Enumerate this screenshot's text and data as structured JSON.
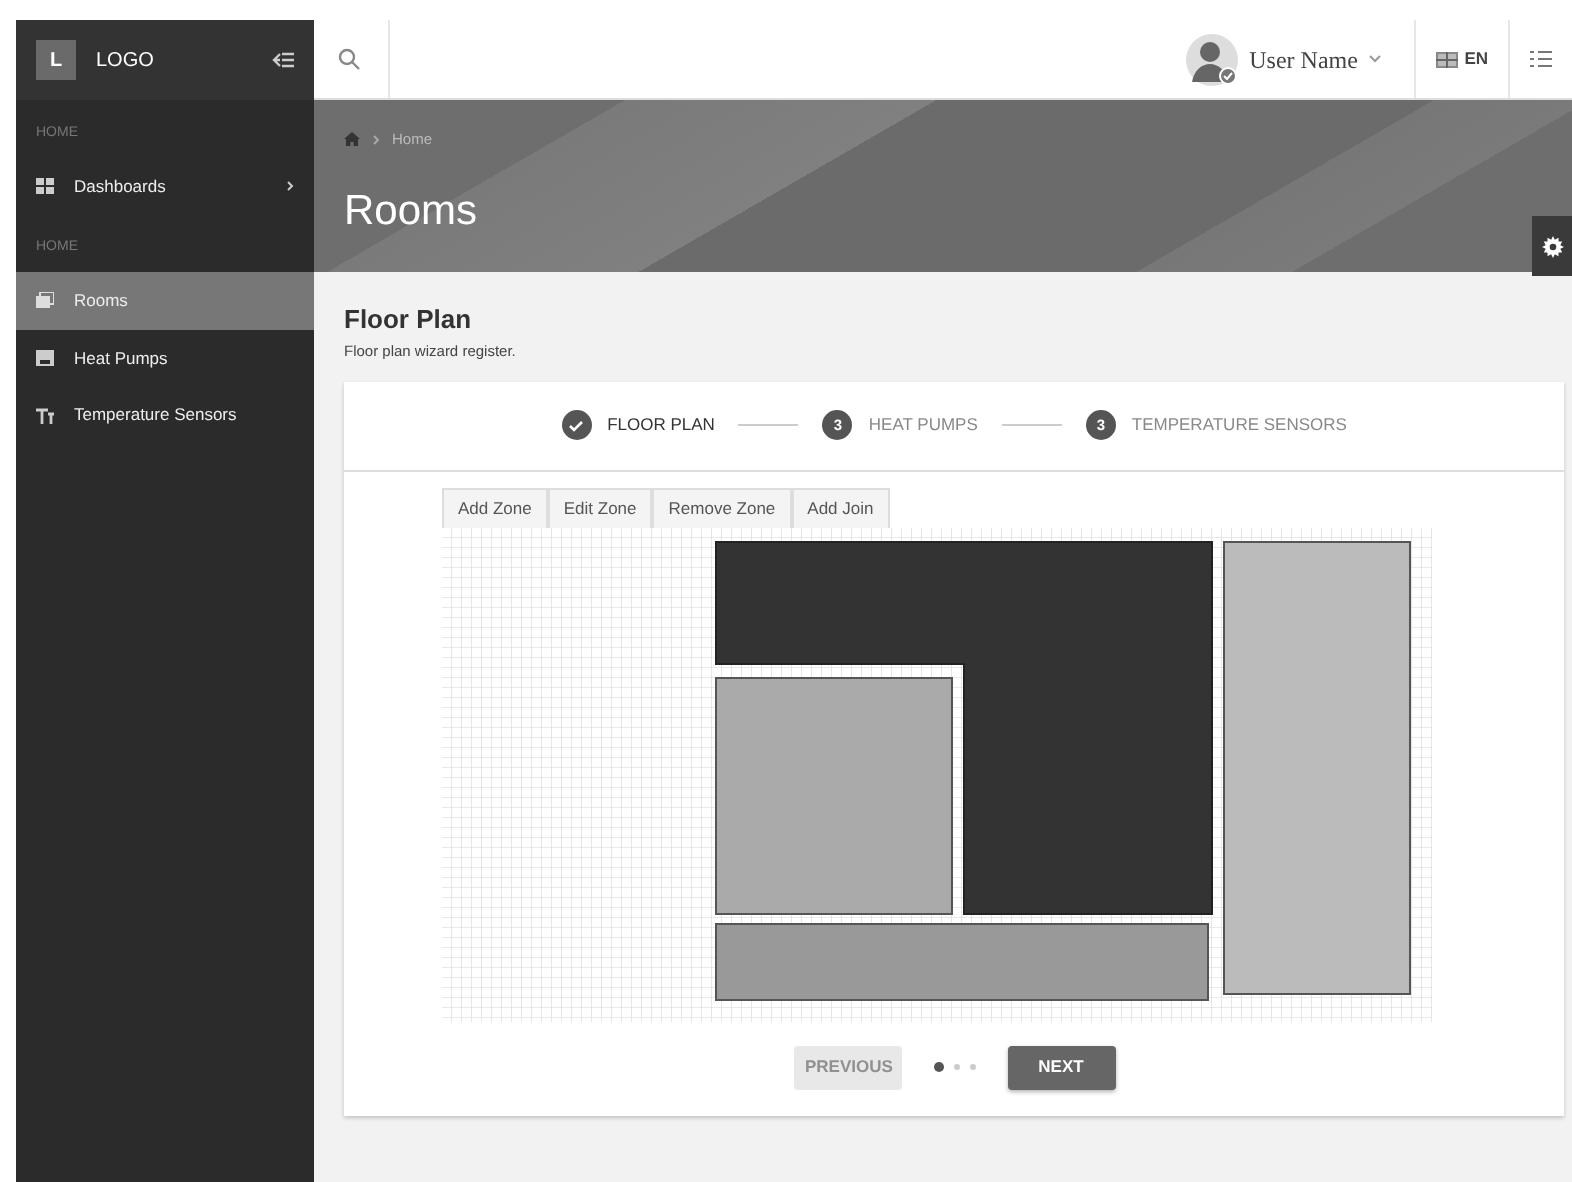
{
  "sidebar": {
    "logo_letter": "L",
    "logo_text": "LOGO",
    "sections": [
      {
        "header": "HOME",
        "items": [
          {
            "label": "Dashboards",
            "has_children": true,
            "selected": false
          }
        ]
      },
      {
        "header": "HOME",
        "items": [
          {
            "label": "Rooms",
            "has_children": false,
            "selected": true
          },
          {
            "label": "Heat Pumps",
            "has_children": false,
            "selected": false
          },
          {
            "label": "Temperature Sensors",
            "has_children": false,
            "selected": false
          }
        ]
      }
    ]
  },
  "topbar": {
    "user_name": "User Name",
    "language": "EN"
  },
  "header": {
    "breadcrumb": "Home",
    "title": "Rooms"
  },
  "section": {
    "title": "Floor Plan",
    "subtitle": "Floor plan wizard register."
  },
  "steps": [
    {
      "label": "FLOOR PLAN",
      "kind": "done",
      "selected": true
    },
    {
      "label": "HEAT PUMPS",
      "kind": "number",
      "number": "3",
      "selected": false
    },
    {
      "label": "TEMPERATURE SENSORS",
      "kind": "number",
      "number": "3",
      "selected": false
    }
  ],
  "toolbar": [
    "Add Zone",
    "Edit Zone",
    "Remove Zone",
    "Add Join"
  ],
  "pager": {
    "previous": {
      "label": "PREVIOUS",
      "disabled": true
    },
    "next": {
      "label": "NEXT",
      "disabled": false
    },
    "dots": [
      {
        "selected": true
      },
      {
        "selected": false
      },
      {
        "selected": false
      }
    ]
  }
}
